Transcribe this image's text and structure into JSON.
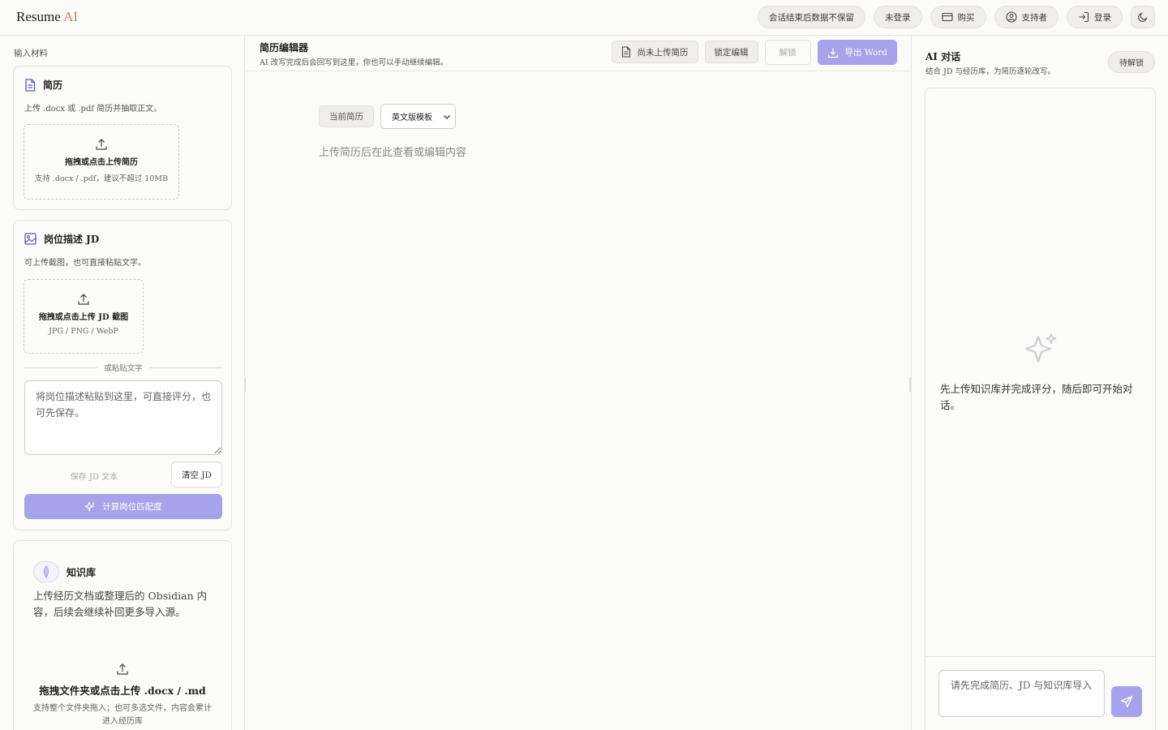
{
  "brand": {
    "name": "Resume",
    "accent": "AI"
  },
  "topbar": {
    "session_note": "会话结束后数据不保留",
    "login_status": "未登录",
    "buy": "购买",
    "supporter": "支持者",
    "login": "登录"
  },
  "left": {
    "section_label": "输入材料",
    "resume": {
      "title": "简历",
      "desc": "上传 .docx 或 .pdf 简历并抽取正文。",
      "drop_title": "拖拽或点击上传简历",
      "drop_hint": "支持 .docx / .pdf，建议不超过 10MB"
    },
    "jd": {
      "title": "岗位描述 JD",
      "desc": "可上传截图，也可直接粘贴文字。",
      "drop_title": "拖拽或点击上传 JD 截图",
      "drop_hint": "JPG / PNG / WebP",
      "divider": "或粘贴文字",
      "textarea_placeholder": "将岗位描述粘贴到这里，可直接评分，也可先保存。",
      "save": "保存 JD 文本",
      "clear": "清空 JD",
      "calc": "计算岗位匹配度"
    },
    "kb": {
      "title": "知识库",
      "desc": "上传经历文档或整理后的 Obsidian 内容，后续会继续补回更多导入源。",
      "drop_title": "拖拽文件夹或点击上传 .docx / .md",
      "drop_hint": "支持整个文件夹拖入；也可多选文件，内容会累计进入经历库"
    }
  },
  "editor": {
    "title": "简历编辑器",
    "subtitle": "AI 改写完成后会回写到这里，你也可以手动继续编辑。",
    "not_uploaded": "尚未上传简历",
    "lock_edit": "锁定编辑",
    "unlock": "解锁",
    "export": "导出 Word",
    "current_resume": "当前简历",
    "template_selected": "英文版模板",
    "placeholder": "上传简历后在此查看或编辑内容"
  },
  "chat": {
    "title": "AI 对话",
    "subtitle": "结合 JD 与经历库，为简历逐轮改写。",
    "status": "待解锁",
    "empty_text": "先上传知识库并完成评分，随后即可开始对话。",
    "input_placeholder": "请先完成简历、JD 与知识库导入"
  },
  "colors": {
    "accent": "#a6a3ec",
    "brand_accent": "#d9774b",
    "icon_blue": "#5a56c9"
  },
  "icons": [
    "document-icon",
    "image-icon",
    "upload-icon",
    "sparkle-icon",
    "download-icon",
    "send-icon",
    "moon-icon",
    "card-icon",
    "user-icon",
    "login-icon",
    "chevron-down-icon",
    "knowledge-icon"
  ]
}
